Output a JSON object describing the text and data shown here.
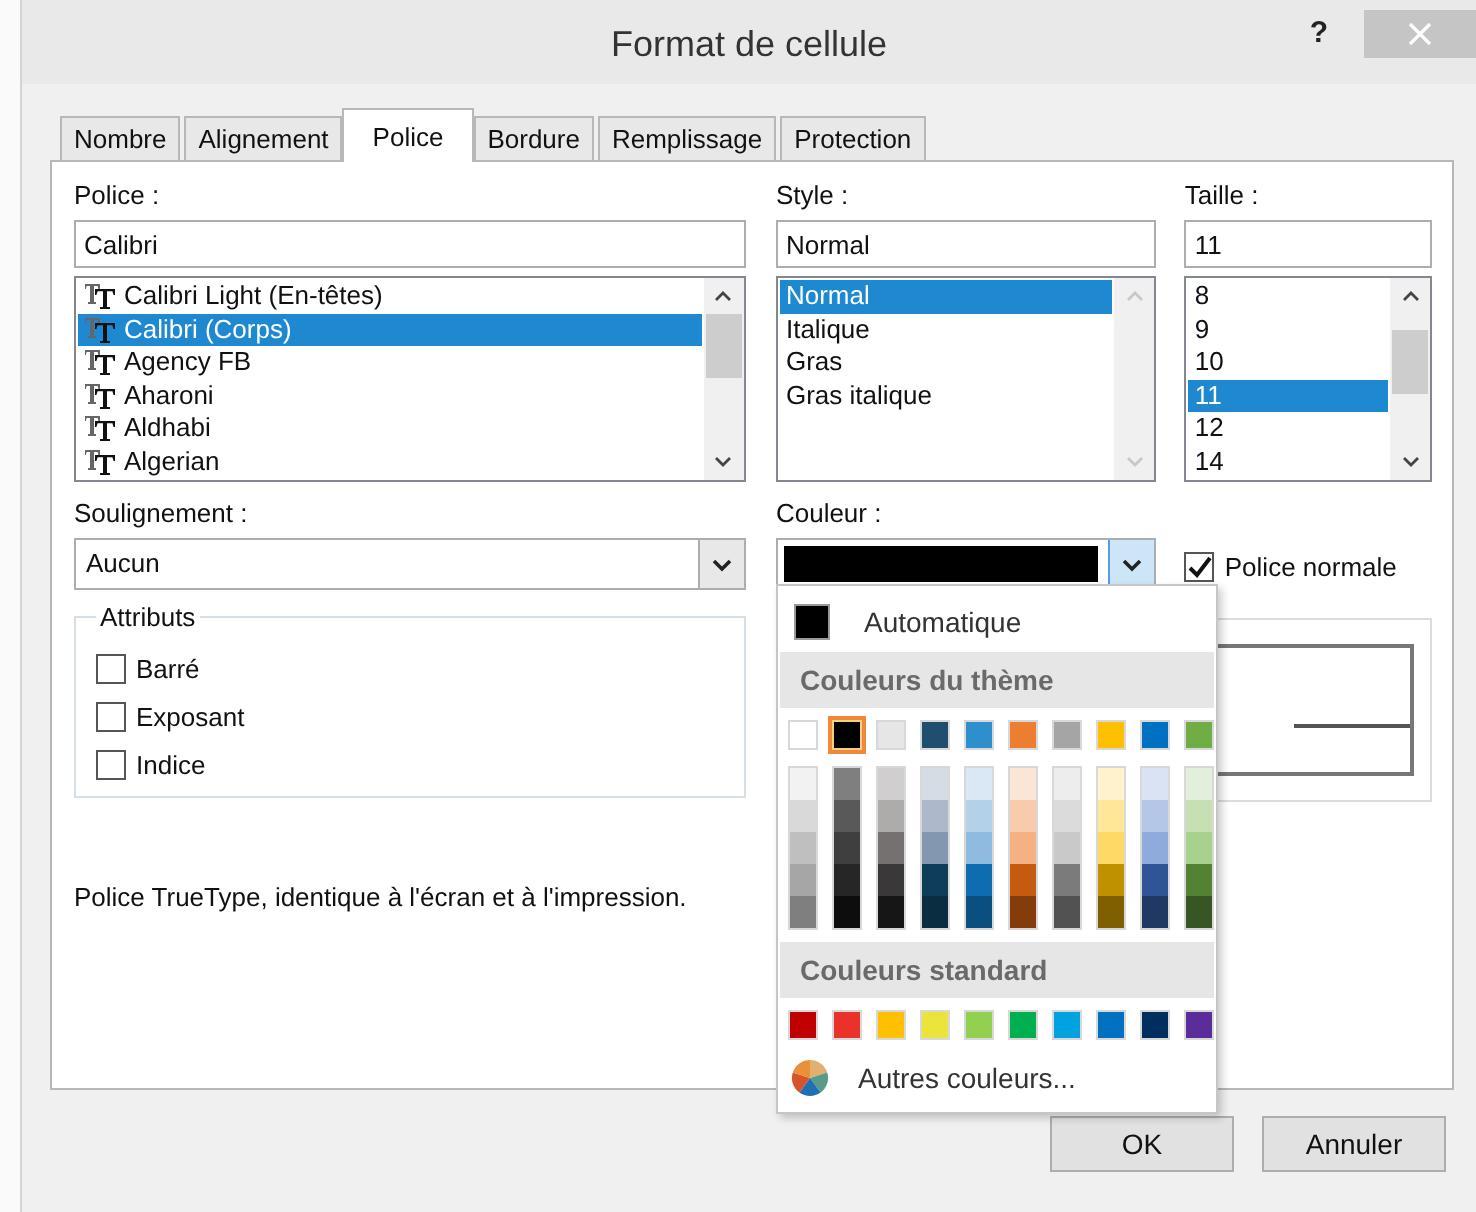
{
  "window": {
    "title": "Format de cellule",
    "help": "?"
  },
  "tabs": [
    {
      "label": "Nombre",
      "selected": false
    },
    {
      "label": "Alignement",
      "selected": false
    },
    {
      "label": "Police",
      "selected": true
    },
    {
      "label": "Bordure",
      "selected": false
    },
    {
      "label": "Remplissage",
      "selected": false
    },
    {
      "label": "Protection",
      "selected": false
    }
  ],
  "font": {
    "label": "Police :",
    "value": "Calibri",
    "items": [
      {
        "label": "Calibri Light (En-têtes)",
        "selected": false
      },
      {
        "label": "Calibri (Corps)",
        "selected": true
      },
      {
        "label": "Agency FB",
        "selected": false
      },
      {
        "label": "Aharoni",
        "selected": false
      },
      {
        "label": "Aldhabi",
        "selected": false
      },
      {
        "label": "Algerian",
        "selected": false
      }
    ]
  },
  "style": {
    "label": "Style :",
    "value": "Normal",
    "items": [
      {
        "label": "Normal",
        "selected": true
      },
      {
        "label": "Italique",
        "selected": false
      },
      {
        "label": "Gras",
        "selected": false
      },
      {
        "label": "Gras italique",
        "selected": false
      }
    ]
  },
  "size": {
    "label": "Taille :",
    "value": "11",
    "items": [
      {
        "label": "8",
        "selected": false
      },
      {
        "label": "9",
        "selected": false
      },
      {
        "label": "10",
        "selected": false
      },
      {
        "label": "11",
        "selected": true
      },
      {
        "label": "12",
        "selected": false
      },
      {
        "label": "14",
        "selected": false
      }
    ]
  },
  "underline": {
    "label": "Soulignement :",
    "value": "Aucun"
  },
  "color": {
    "label": "Couleur :",
    "color": "#000000",
    "expanded": true
  },
  "normal_font": {
    "label": "Police normale",
    "checked": true
  },
  "attributes": {
    "title": "Attributs",
    "items": [
      {
        "label": "Barré",
        "checked": false
      },
      {
        "label": "Exposant",
        "checked": false
      },
      {
        "label": "Indice",
        "checked": false
      }
    ]
  },
  "description": "Police TrueType, identique à l'écran et à l'impression.",
  "color_menu": {
    "automatic": {
      "label": "Automatique",
      "color": "#000000"
    },
    "theme_title": "Couleurs du thème",
    "theme_colors": [
      {
        "color": "#ffffff",
        "selected": false,
        "shades": [
          {
            "color": "#f2f2f2"
          },
          {
            "color": "#d9d9d9"
          },
          {
            "color": "#bfbfbf"
          },
          {
            "color": "#a6a6a6"
          },
          {
            "color": "#7f7f7f"
          }
        ]
      },
      {
        "color": "#000000",
        "selected": true,
        "shades": [
          {
            "color": "#7f7f7f"
          },
          {
            "color": "#595959"
          },
          {
            "color": "#3f3f3f"
          },
          {
            "color": "#262626"
          },
          {
            "color": "#0d0d0d"
          }
        ]
      },
      {
        "color": "#e7e6e6",
        "selected": false,
        "shades": [
          {
            "color": "#d0cece"
          },
          {
            "color": "#aeabab"
          },
          {
            "color": "#757171"
          },
          {
            "color": "#3a3838"
          },
          {
            "color": "#171616"
          }
        ]
      },
      {
        "color": "#1f4e6e",
        "selected": false,
        "shades": [
          {
            "color": "#d6dce4"
          },
          {
            "color": "#adb9ca"
          },
          {
            "color": "#8497b0"
          },
          {
            "color": "#0e3d5a"
          },
          {
            "color": "#0a2d42"
          }
        ]
      },
      {
        "color": "#2e8fcd",
        "selected": false,
        "shades": [
          {
            "color": "#d9e8f4"
          },
          {
            "color": "#b3d1e9"
          },
          {
            "color": "#8fbbe0"
          },
          {
            "color": "#0e6db1"
          },
          {
            "color": "#0b4f80"
          }
        ]
      },
      {
        "color": "#ed7d31",
        "selected": false,
        "shades": [
          {
            "color": "#fbe5d6"
          },
          {
            "color": "#f8cbad"
          },
          {
            "color": "#f4b183"
          },
          {
            "color": "#c55a11"
          },
          {
            "color": "#843c0c"
          }
        ]
      },
      {
        "color": "#a5a5a5",
        "selected": false,
        "shades": [
          {
            "color": "#ededed"
          },
          {
            "color": "#dbdbdb"
          },
          {
            "color": "#c9c9c9"
          },
          {
            "color": "#7b7b7b"
          },
          {
            "color": "#525252"
          }
        ]
      },
      {
        "color": "#ffc000",
        "selected": false,
        "shades": [
          {
            "color": "#fff2cc"
          },
          {
            "color": "#ffe699"
          },
          {
            "color": "#ffd966"
          },
          {
            "color": "#bf9000"
          },
          {
            "color": "#7f6000"
          }
        ]
      },
      {
        "color": "#0070c0",
        "selected": false,
        "shades": [
          {
            "color": "#dae3f3"
          },
          {
            "color": "#b4c7e7"
          },
          {
            "color": "#8faadc"
          },
          {
            "color": "#2f5597"
          },
          {
            "color": "#203864"
          }
        ]
      },
      {
        "color": "#70ad47",
        "selected": false,
        "shades": [
          {
            "color": "#e2efda"
          },
          {
            "color": "#c6e0b4"
          },
          {
            "color": "#a9d18e"
          },
          {
            "color": "#548235"
          },
          {
            "color": "#375623"
          }
        ]
      }
    ],
    "standard_title": "Couleurs standard",
    "standard_colors": [
      {
        "color": "#c00000"
      },
      {
        "color": "#e8322a"
      },
      {
        "color": "#ffc000"
      },
      {
        "color": "#ebe43a"
      },
      {
        "color": "#92d050"
      },
      {
        "color": "#00b050"
      },
      {
        "color": "#00a3e0"
      },
      {
        "color": "#0070c0"
      },
      {
        "color": "#002f5f"
      },
      {
        "color": "#5b2d9a"
      }
    ],
    "more": "Autres couleurs..."
  },
  "buttons": [
    "OK",
    "Annuler"
  ]
}
